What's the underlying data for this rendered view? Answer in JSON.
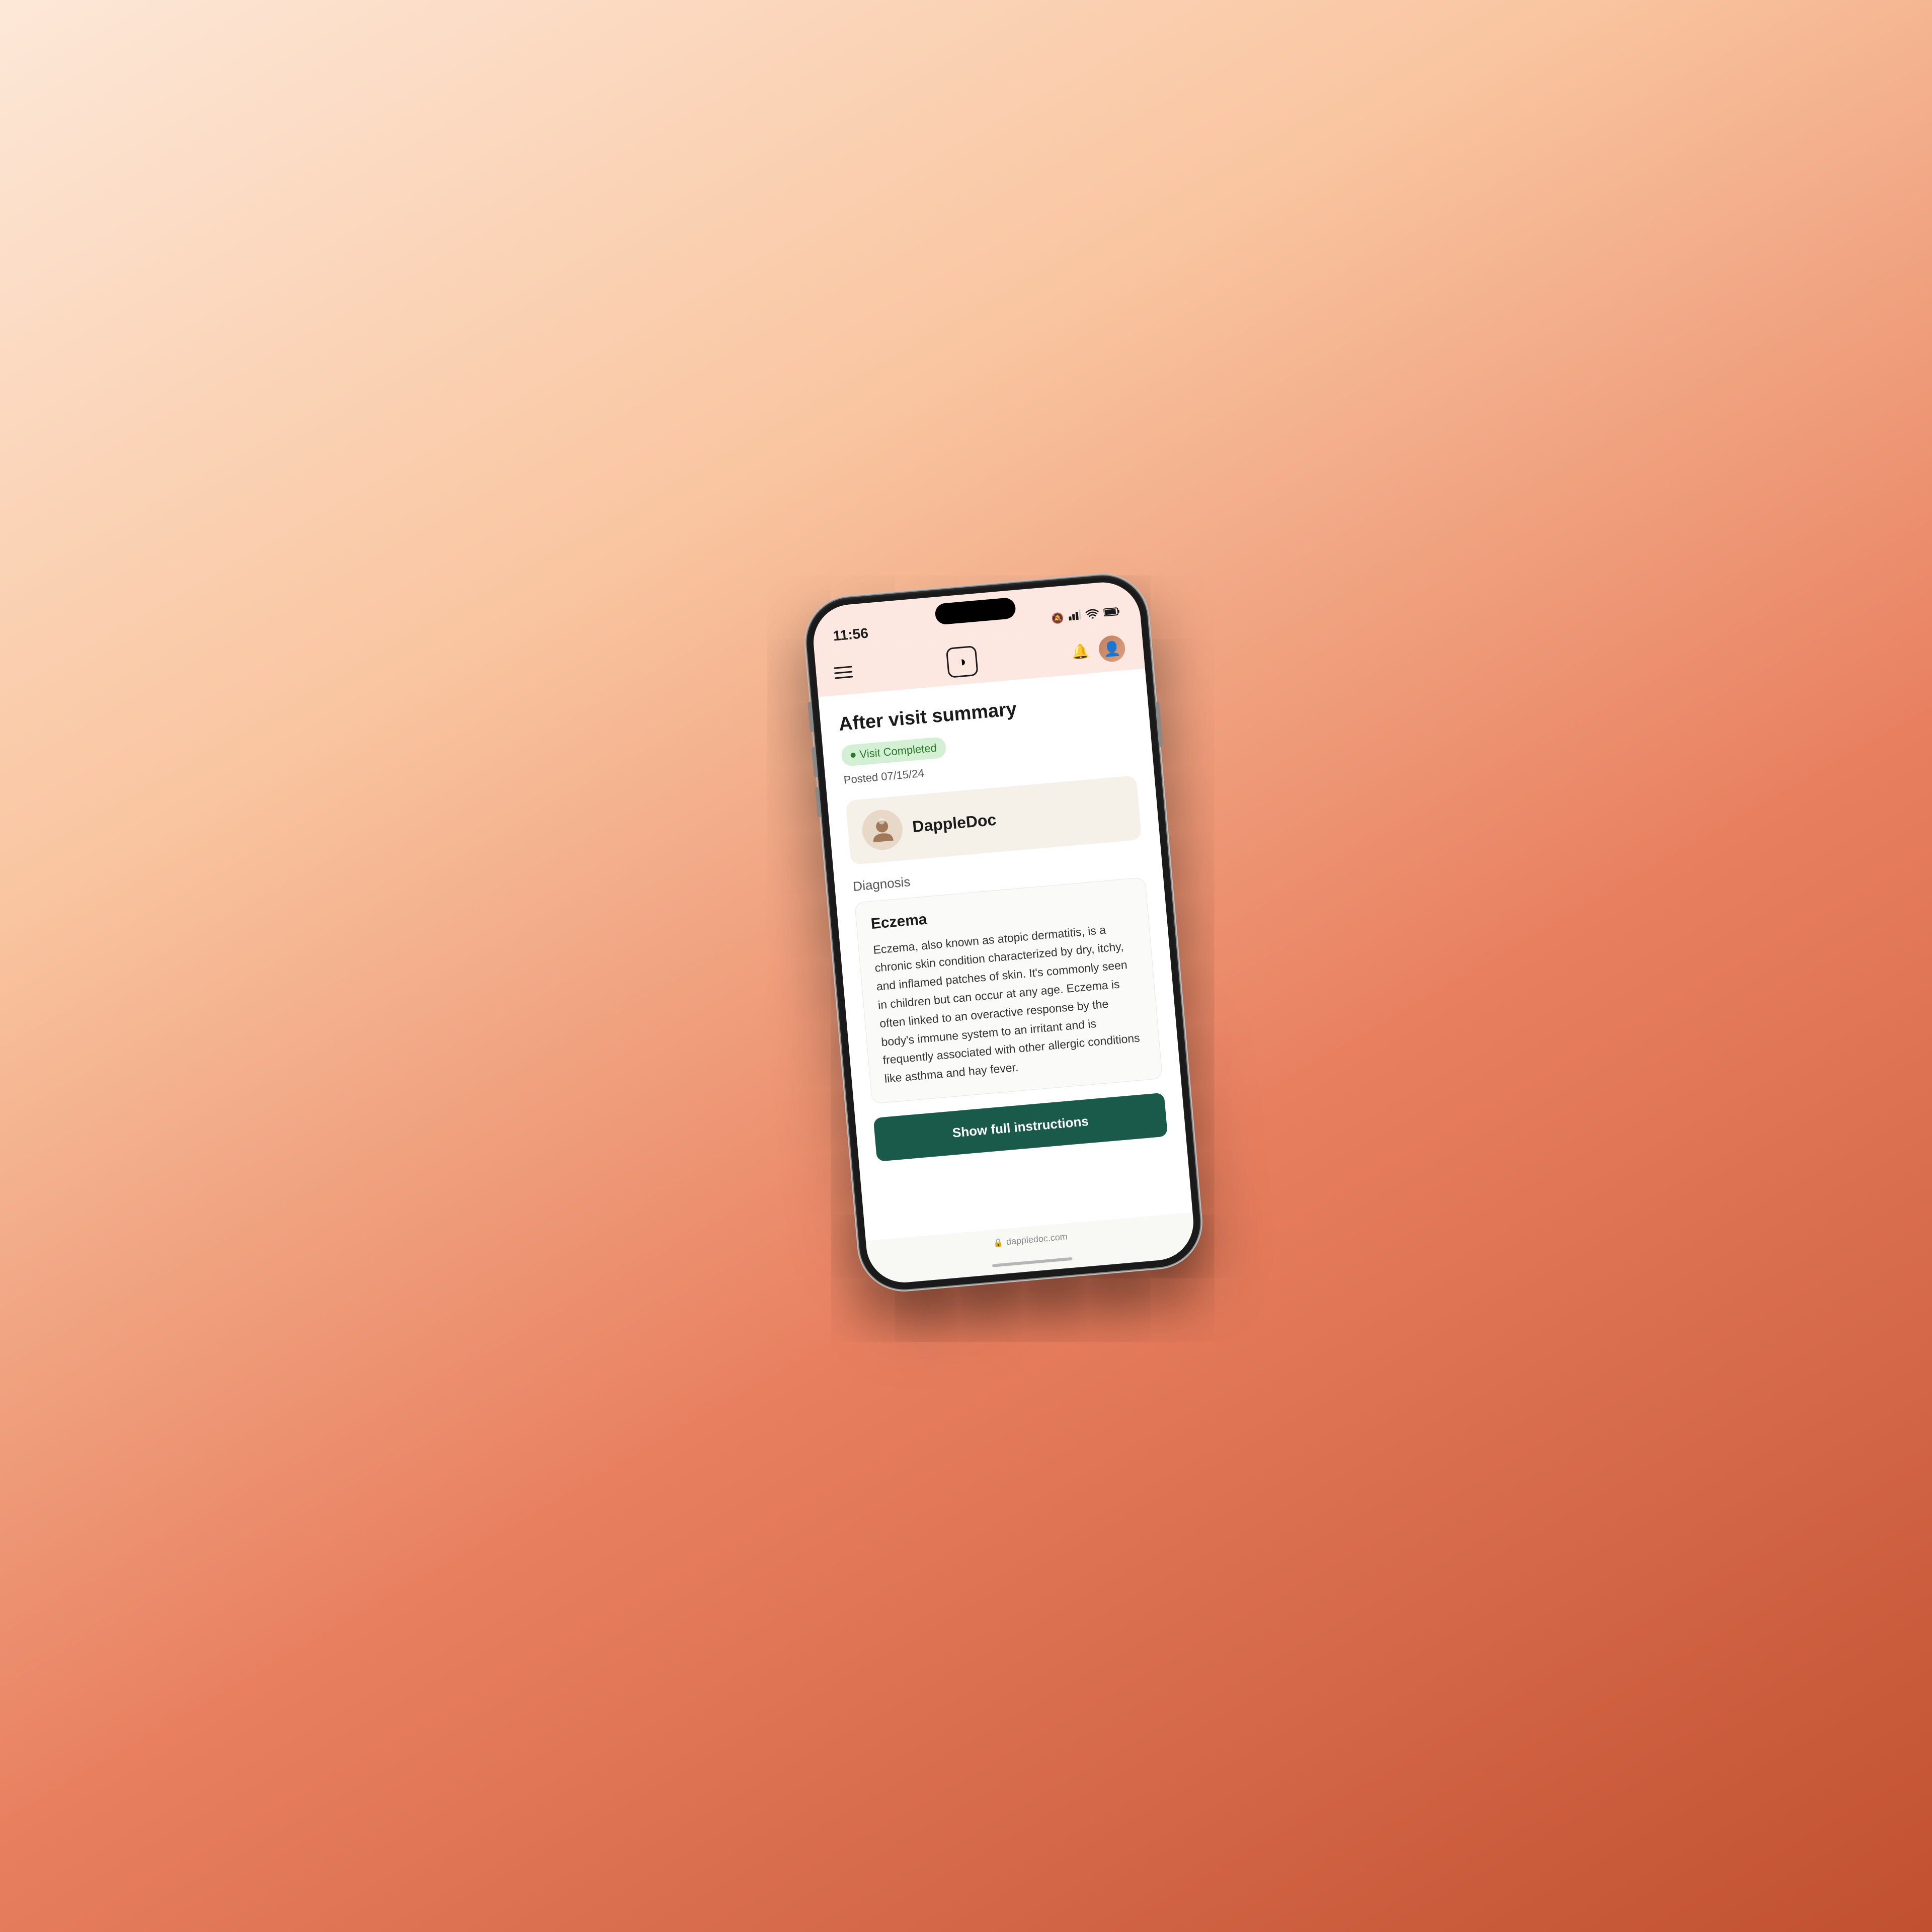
{
  "background": {
    "gradient_start": "#fde8d8",
    "gradient_end": "#f08080"
  },
  "phone": {
    "status_bar": {
      "time": "11:56",
      "bell_icon": "🔕",
      "signal_bars": "▂▄▆",
      "wifi": "wifi-icon",
      "battery": "battery-icon"
    },
    "nav_bar": {
      "menu_label": "menu",
      "logo_symbol": "◑",
      "bell_label": "notifications",
      "avatar_label": "user-avatar"
    },
    "content": {
      "page_title": "After visit summary",
      "status_badge": {
        "text": "Visit Completed",
        "dot_color": "#2a7a2a",
        "bg_color": "#d4f0d4",
        "text_color": "#2a7a2a"
      },
      "posted_date": "Posted 07/15/24",
      "provider": {
        "name": "DappleDoc",
        "avatar_emoji": "👩‍⚕️"
      },
      "diagnosis_label": "Diagnosis",
      "diagnosis_card": {
        "title": "Eczema",
        "body": "Eczema, also known as atopic dermatitis, is a chronic skin condition characterized by dry, itchy, and inflamed patches of skin. It's commonly seen in children but can occur at any age. Eczema is often linked to an overactive response by the body's immune system to an irritant and is frequently associated with other allergic conditions like asthma and hay fever."
      },
      "cta_button": {
        "label": "Show full instructions",
        "bg_color": "#1a5a4a"
      }
    },
    "footer": {
      "url": "dappledoc.com",
      "lock_icon": "🔒"
    }
  }
}
